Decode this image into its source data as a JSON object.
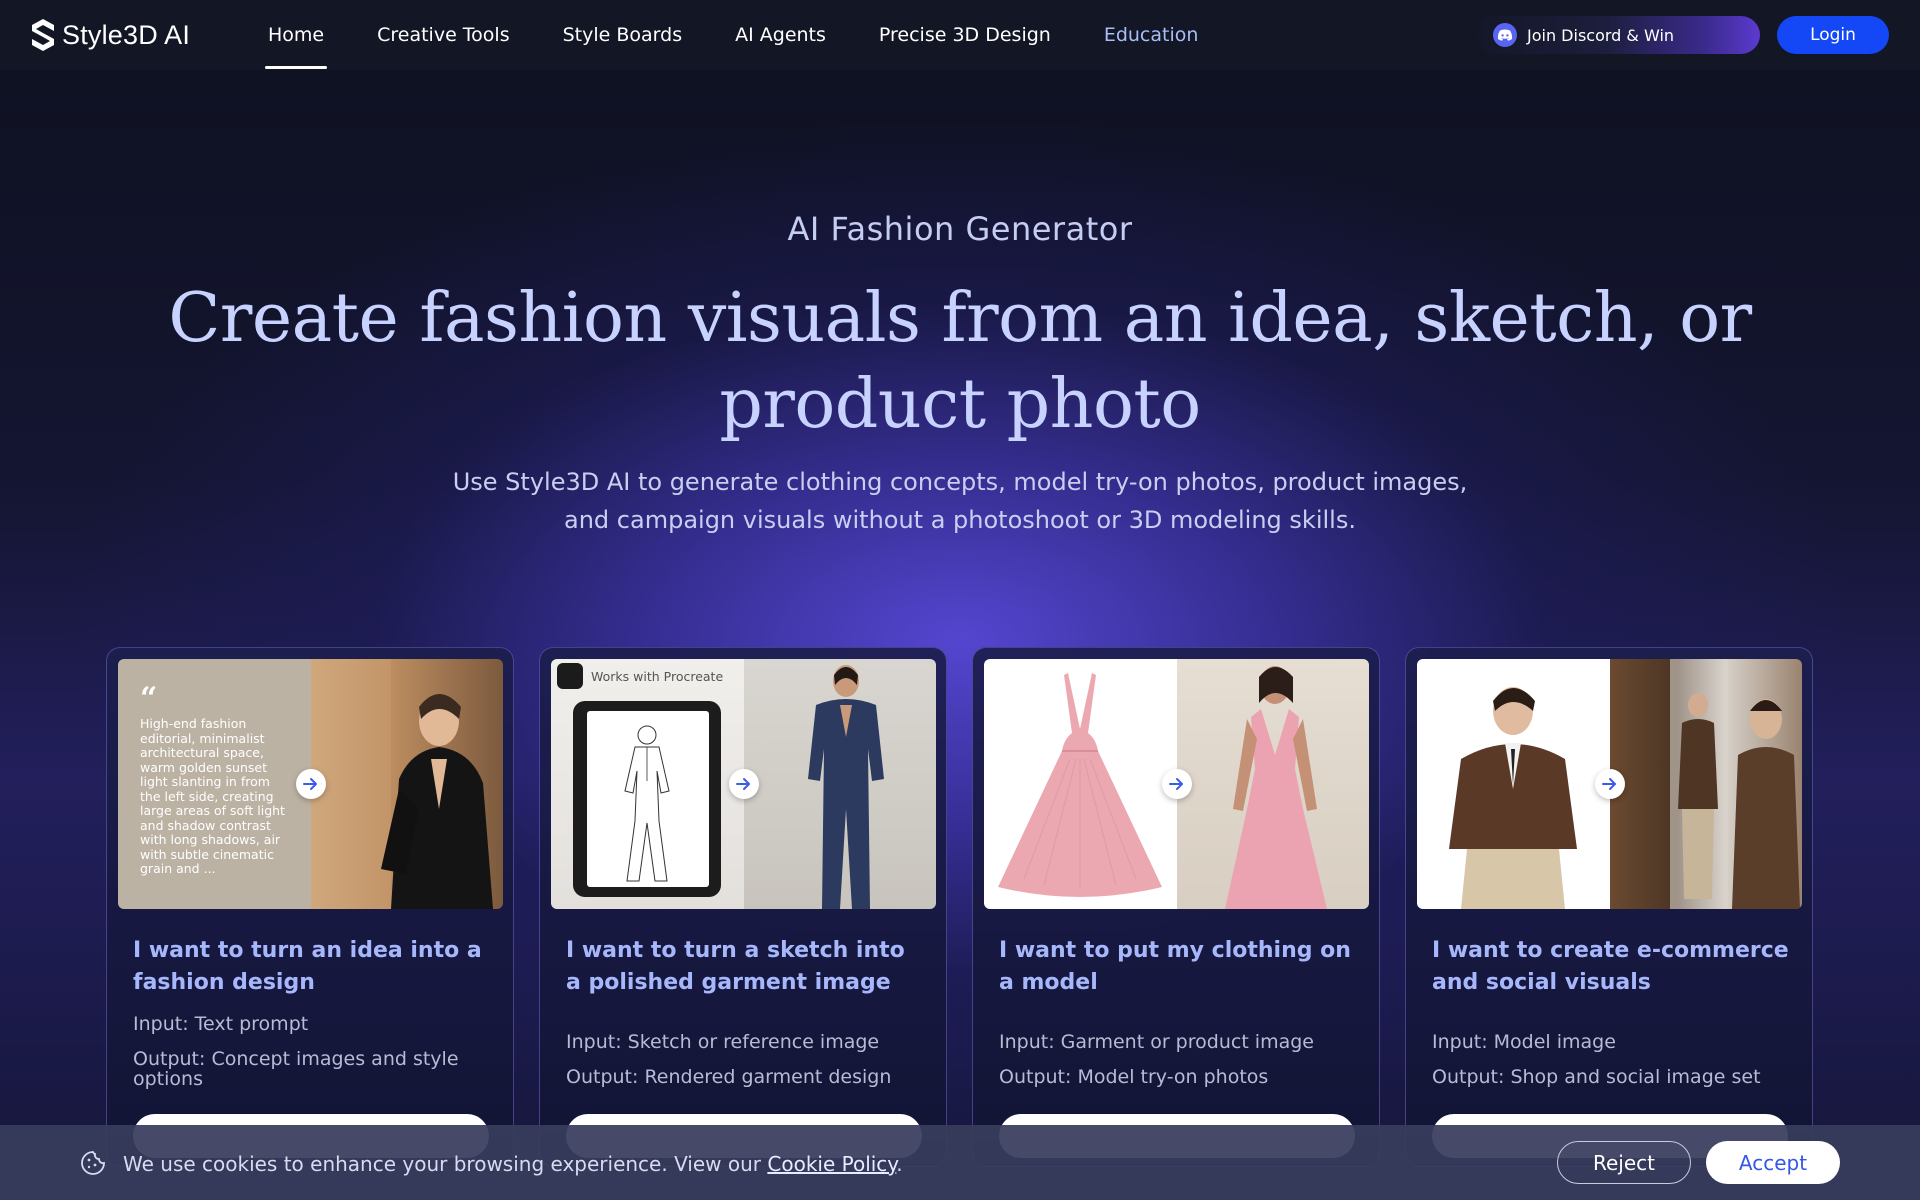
{
  "brand": {
    "name": "Style3D AI"
  },
  "nav": {
    "links": [
      {
        "label": "Home"
      },
      {
        "label": "Creative Tools"
      },
      {
        "label": "Style Boards"
      },
      {
        "label": "AI Agents"
      },
      {
        "label": "Precise 3D Design"
      },
      {
        "label": "Education"
      }
    ],
    "discord_label": "Join Discord & Win",
    "login_label": "Login"
  },
  "hero": {
    "eyebrow": "AI Fashion Generator",
    "headline": "Create fashion visuals from an idea, sketch, or product photo",
    "subtitle_line1": "Use Style3D AI to generate clothing concepts, model try-on photos, product images,",
    "subtitle_line2": "and campaign visuals without a photoshoot or 3D modeling skills."
  },
  "cards": [
    {
      "title": "I want to turn an idea into a fashion design",
      "input": "Input: Text prompt",
      "output": "Output: Concept images and style options",
      "quote": "High-end fashion editorial, minimalist architectural space, warm golden sunset light slanting in from the left side, creating large areas of soft light and shadow contrast with long shadows, air with subtle cinematic grain and ..."
    },
    {
      "title": "I want to turn a sketch into a polished garment image",
      "input": "Input: Sketch or reference image",
      "output": "Output: Rendered garment design",
      "badge": "Works with Procreate"
    },
    {
      "title": "I want to put my clothing on a model",
      "input": "Input: Garment or product image",
      "output": "Output: Model try-on photos"
    },
    {
      "title": "I want to create e-commerce and social visuals",
      "input": "Input: Model image",
      "output": "Output: Shop and social image set"
    }
  ],
  "cookie": {
    "text": "We use cookies to enhance your browsing experience. View our ",
    "link": "Cookie Policy",
    "suffix": ".",
    "reject": "Reject",
    "accept": "Accept"
  }
}
